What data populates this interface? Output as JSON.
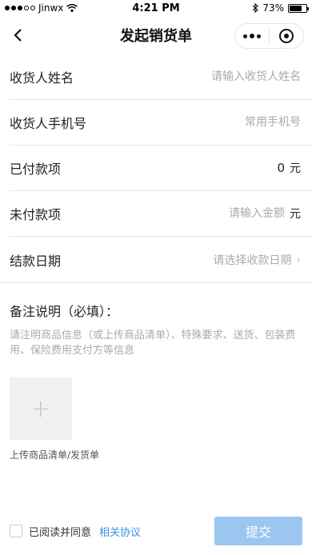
{
  "status_bar": {
    "carrier": "Jinwx",
    "time": "4:21 PM",
    "battery": "73%",
    "battery_level": 0.73
  },
  "nav": {
    "title": "发起销货单"
  },
  "form": {
    "receiver_name": {
      "label": "收货人姓名",
      "placeholder": "请输入收货人姓名"
    },
    "receiver_phone": {
      "label": "收货人手机号",
      "placeholder": "常用手机号"
    },
    "paid": {
      "label": "已付款项",
      "value": "0",
      "unit": "元"
    },
    "unpaid": {
      "label": "未付款项",
      "placeholder": "请输入金额",
      "unit": "元"
    },
    "settle_date": {
      "label": "结款日期",
      "placeholder": "请选择收款日期",
      "chevron": "›"
    }
  },
  "remark": {
    "title": "备注说明（必填）：",
    "placeholder": "请注明商品信息（或上传商品清单）、特殊要求、送货、包装费用、保险费用支付方等信息"
  },
  "upload": {
    "plus": "+",
    "caption": "上传商品清单/发货单"
  },
  "footer": {
    "agree_text": "已阅读并同意",
    "agree_link": "相关协议",
    "submit_label": "提交"
  },
  "icons": {
    "back": "back-icon",
    "more": "more-icon",
    "close": "target-icon",
    "wifi": "wifi-icon",
    "bluetooth": "bluetooth-icon"
  }
}
